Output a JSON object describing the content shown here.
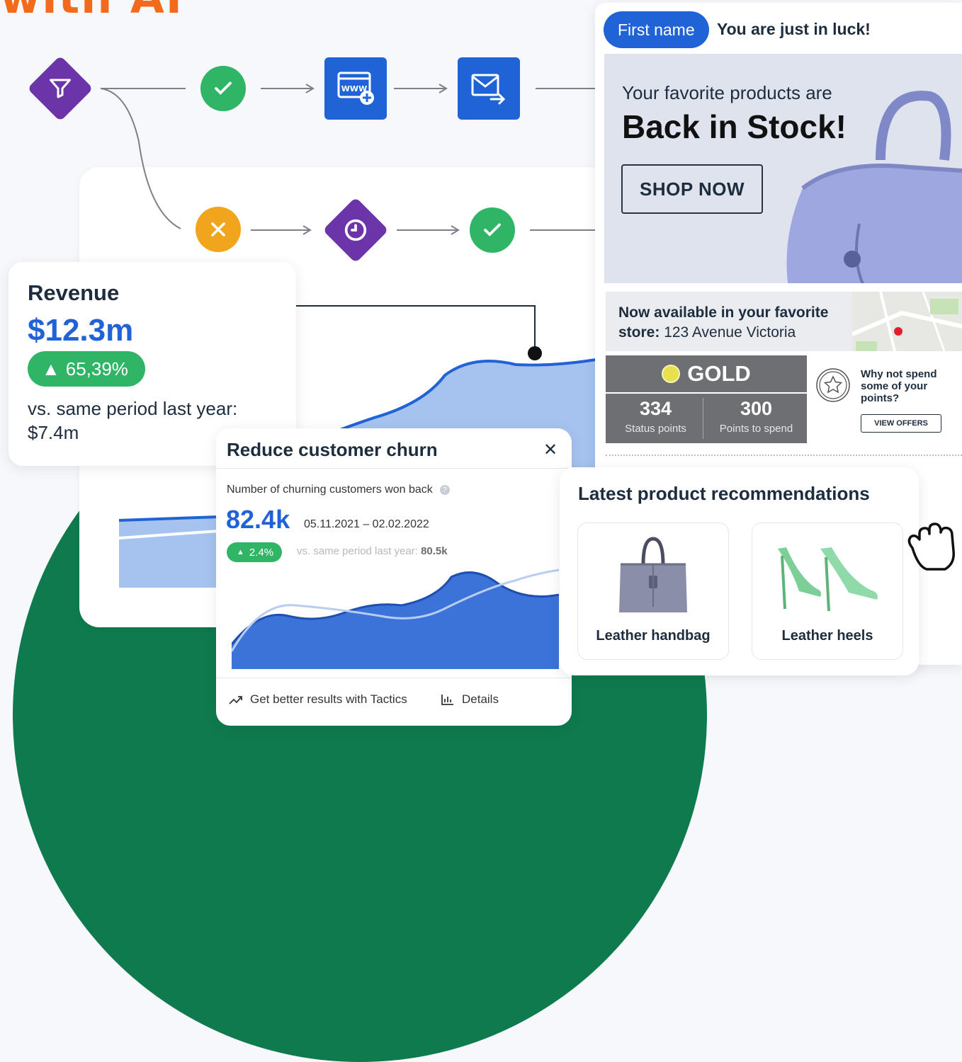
{
  "headline_fragment": "with AI",
  "flow": {
    "icons": {
      "filter": "filter-icon",
      "check": "check-icon",
      "www": "web-page-icon",
      "email": "email-send-icon",
      "cancel": "x-icon",
      "clock": "clock-icon"
    }
  },
  "revenue": {
    "title": "Revenue",
    "value": "$12.3m",
    "change": "65,39%",
    "compare": "vs. same period last year: $7.4m"
  },
  "email": {
    "first_name_pill": "First name",
    "greeting": "You are just in luck!",
    "hero_sub": "Your favorite products are",
    "hero_title": "Back in Stock!",
    "shop_button": "SHOP NOW",
    "store_label": "Now available in your favorite store:",
    "store_address": "123 Avenue Victoria",
    "loyalty": {
      "tier": "GOLD",
      "status_points": "334",
      "status_points_label": "Status points",
      "points_to_spend": "300",
      "points_to_spend_label": "Points to spend",
      "offer_text": "Why not spend some of your points?",
      "offer_button": "VIEW OFFERS"
    }
  },
  "churn": {
    "title": "Reduce customer churn",
    "metric_label": "Number of churning customers won back",
    "value": "82.4k",
    "date_range": "05.11.2021 – 02.02.2022",
    "change": "2.4%",
    "compare_prefix": "vs. same period last year:",
    "compare_value": "80.5k",
    "footer_tactics": "Get better results with Tactics",
    "footer_details": "Details"
  },
  "recommendations": {
    "title": "Latest product recommendations",
    "products": [
      {
        "name": "Leather handbag"
      },
      {
        "name": "Leather heels"
      }
    ]
  },
  "colors": {
    "brand_blue": "#1f63d6",
    "success_green": "#30b566",
    "flow_purple": "#6b34a8",
    "warning_orange": "#f0a51c",
    "accent_orange": "#f26b1d",
    "dark_green": "#0f7a4e"
  }
}
